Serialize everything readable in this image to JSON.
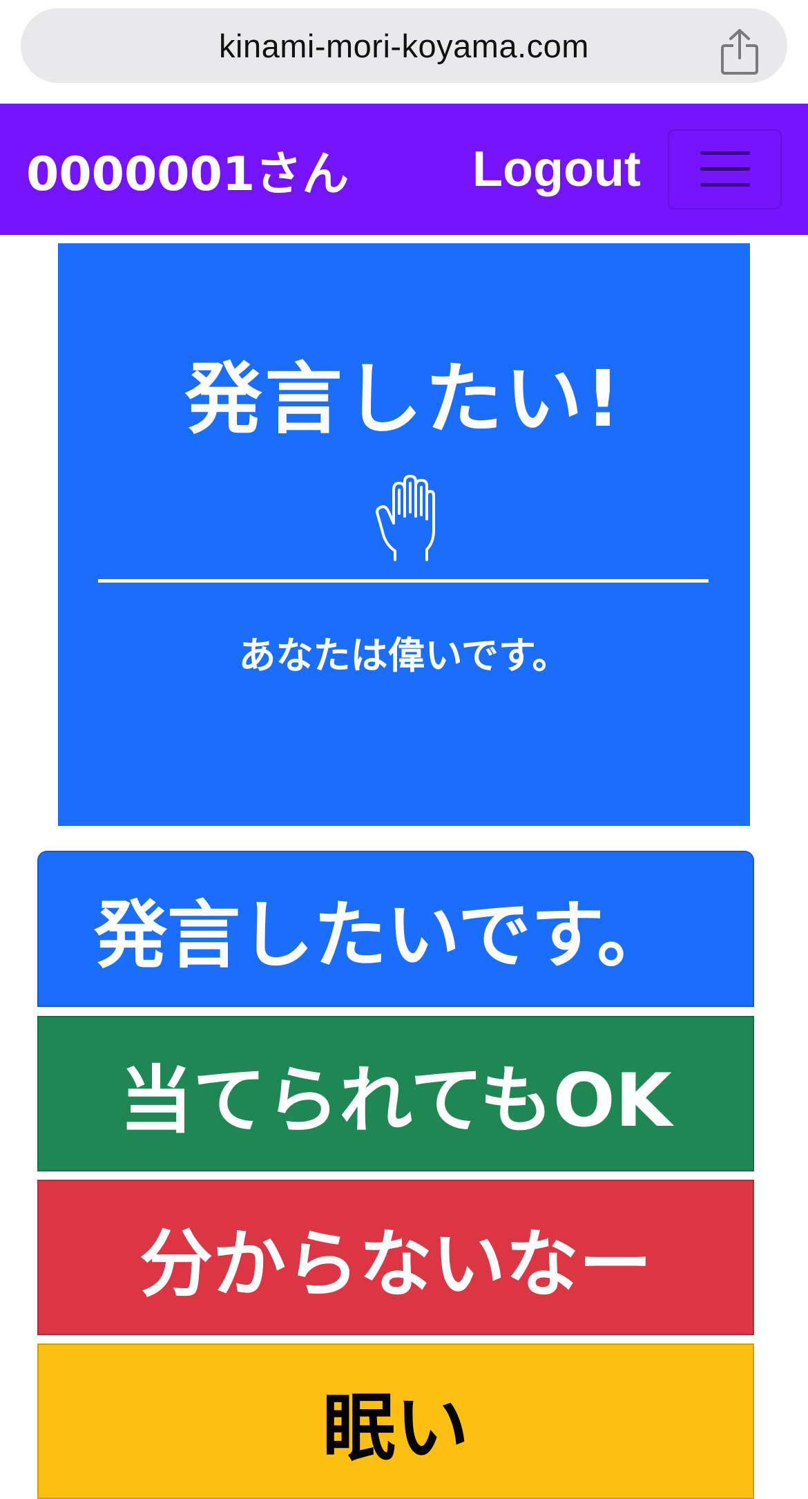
{
  "browser": {
    "url": "kinami-mori-koyama.com",
    "share_icon": "share-icon"
  },
  "header": {
    "user_label": "0000001さん",
    "logout_label": "Logout",
    "menu_icon": "hamburger-menu-icon",
    "background_color": "#7513fd"
  },
  "card": {
    "title": "発言したい!",
    "icon": "raised-hand-icon",
    "message": "あなたは偉いです。",
    "background_color": "#1a6efb"
  },
  "actions": [
    {
      "label": "発言したいです。",
      "color": "#1a6efb"
    },
    {
      "label": "当てられてもOK",
      "color": "#1f8754"
    },
    {
      "label": "分からないなー",
      "color": "#dc3645"
    },
    {
      "label": "眠い",
      "color": "#fdc010"
    }
  ]
}
